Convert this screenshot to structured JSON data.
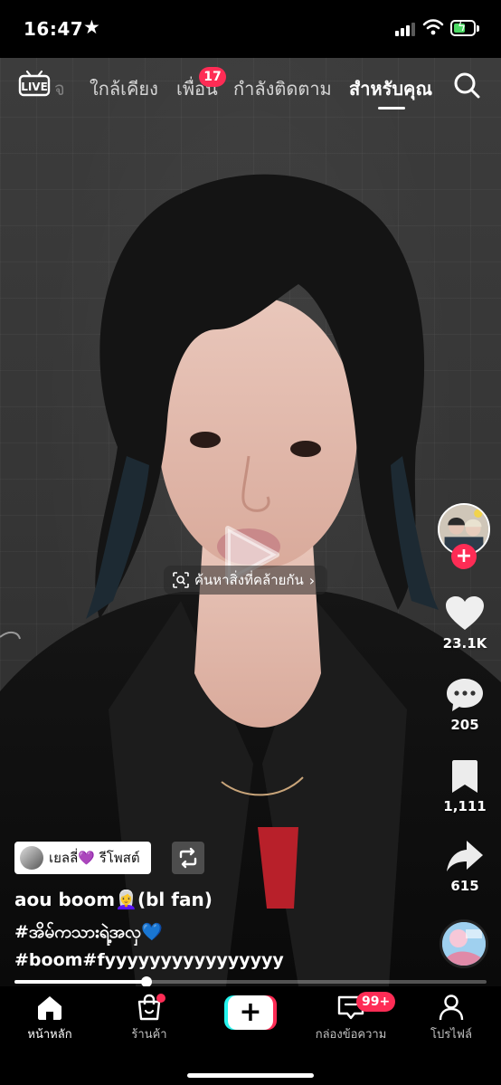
{
  "status_bar": {
    "time": "16:47"
  },
  "top_nav": {
    "live_label": "LIVE",
    "tabs": [
      {
        "label": "ใกล้เคียง"
      },
      {
        "label": "เพื่อน",
        "badge": "17"
      },
      {
        "label": "กำลังติดตาม"
      },
      {
        "label": "สำหรับคุณ",
        "active": true
      }
    ],
    "faded_text": "จ"
  },
  "video": {
    "similar_search_label": "ค้นหาสิ่งที่คล้ายกัน"
  },
  "right_rail": {
    "likes": "23.1K",
    "comments": "205",
    "saves": "1,111",
    "shares": "615"
  },
  "caption": {
    "repost_label": "เยลลี่💜 รีโพสต์",
    "username": "aou boom👩‍🦳(bl fan)",
    "hashtag_line1": "#အိမ်ကသားရဲ့အလှ💙",
    "hashtag_line2": "#boom#fyyyyyyyyyyyyyyyy"
  },
  "progress": {
    "played_fraction": 0.28
  },
  "bottom_nav": {
    "tabs": [
      {
        "label": "หน้าหลัก",
        "active": true
      },
      {
        "label": "ร้านค้า"
      },
      {
        "label": ""
      },
      {
        "label": "กล่องข้อความ",
        "badge": "99+"
      },
      {
        "label": "โปรไฟล์"
      }
    ]
  },
  "colors": {
    "accent_red": "#fe2c55",
    "accent_cyan": "#25f4ee",
    "battery_green": "#4cd964"
  }
}
